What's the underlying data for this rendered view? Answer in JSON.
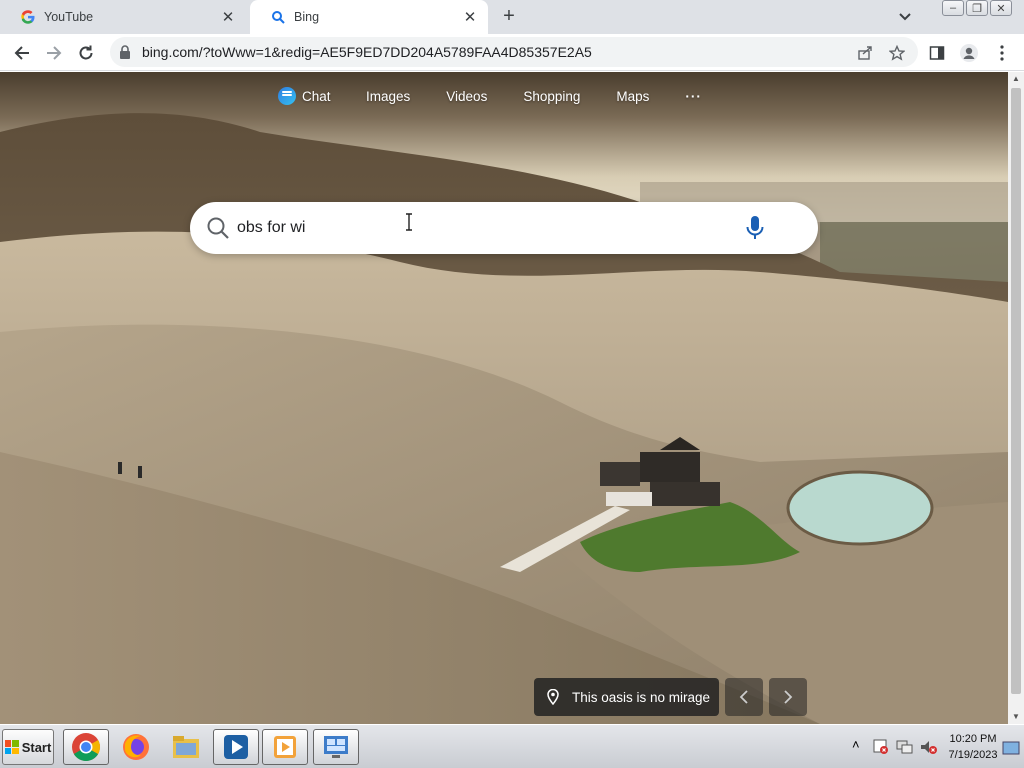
{
  "browser": {
    "tabs": [
      {
        "title": "YouTube",
        "icon": "google-g-icon",
        "active": false
      },
      {
        "title": "Bing",
        "icon": "bing-search-icon",
        "active": true
      }
    ],
    "new_tab_label": "+",
    "address": "bing.com/?toWww=1&redig=AE5F9ED7DD204A5789FAA4D85357E2A5"
  },
  "bing": {
    "nav": [
      {
        "label": "Chat"
      },
      {
        "label": "Images"
      },
      {
        "label": "Videos"
      },
      {
        "label": "Shopping"
      },
      {
        "label": "Maps"
      },
      {
        "label": "···"
      }
    ],
    "search_value": "obs for wi",
    "caption": "This oasis is no mirage",
    "accent_colors": {
      "chat_start": "#2f7de1",
      "chat_end": "#35c1f1",
      "mic": "#1a5fb4"
    }
  },
  "taskbar": {
    "start_label": "Start",
    "apps": [
      "chrome-icon",
      "firefox-icon",
      "file-explorer-icon",
      "media-player-icon",
      "video-app-icon",
      "control-panel-icon"
    ],
    "clock_time": "10:20 PM",
    "clock_date": "7/19/2023"
  }
}
